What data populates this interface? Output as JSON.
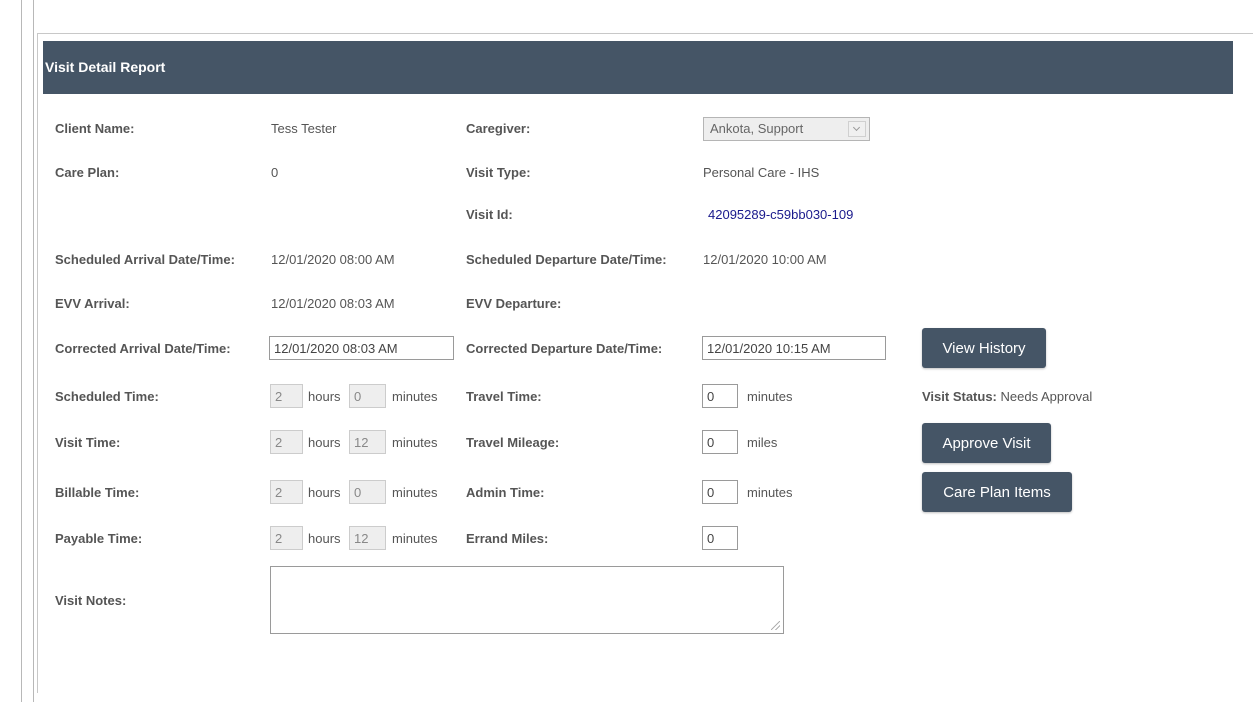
{
  "report": {
    "title": "Visit Detail Report"
  },
  "left": {
    "client_name_label": "Client Name:",
    "client_name": "Tess Tester",
    "care_plan_label": "Care Plan:",
    "care_plan": "0",
    "sched_arrival_label": "Scheduled Arrival Date/Time:",
    "sched_arrival": "12/01/2020 08:00 AM",
    "evv_arrival_label": "EVV Arrival:",
    "evv_arrival": "12/01/2020 08:03 AM",
    "corrected_arrival_label": "Corrected Arrival Date/Time:",
    "corrected_arrival": "12/01/2020 08:03 AM",
    "scheduled_time_label": "Scheduled Time:",
    "visit_time_label": "Visit Time:",
    "billable_time_label": "Billable Time:",
    "payable_time_label": "Payable Time:",
    "visit_notes_label": "Visit Notes:"
  },
  "times": {
    "scheduled": {
      "hours": "2",
      "minutes": "0"
    },
    "visit": {
      "hours": "2",
      "minutes": "12"
    },
    "billable": {
      "hours": "2",
      "minutes": "0"
    },
    "payable": {
      "hours": "2",
      "minutes": "12"
    },
    "hours_unit": "hours",
    "minutes_unit": "minutes"
  },
  "middle": {
    "caregiver_label": "Caregiver:",
    "caregiver_selected": "Ankota, Support",
    "visit_type_label": "Visit Type:",
    "visit_type": "Personal Care - IHS",
    "visit_id_label": "Visit Id:",
    "visit_id": "42095289-c59bb030-109",
    "sched_departure_label": "Scheduled Departure Date/Time:",
    "sched_departure": "12/01/2020 10:00 AM",
    "evv_departure_label": "EVV Departure:",
    "corrected_departure_label": "Corrected Departure Date/Time:",
    "corrected_departure": "12/01/2020 10:15 AM",
    "travel_time_label": "Travel Time:",
    "travel_time": "0",
    "travel_time_unit": "minutes",
    "travel_mileage_label": "Travel Mileage:",
    "travel_mileage": "0",
    "travel_mileage_unit": "miles",
    "admin_time_label": "Admin Time:",
    "admin_time": "0",
    "admin_time_unit": "minutes",
    "errand_miles_label": "Errand Miles:",
    "errand_miles": "0"
  },
  "right": {
    "view_history_label": "View History",
    "visit_status_label": "Visit Status:",
    "visit_status": "Needs Approval",
    "approve_visit_label": "Approve Visit",
    "care_plan_items_label": "Care Plan Items"
  },
  "colors": {
    "header_bg": "#455566",
    "button_bg": "#455566",
    "link": "#1a1a8c"
  }
}
